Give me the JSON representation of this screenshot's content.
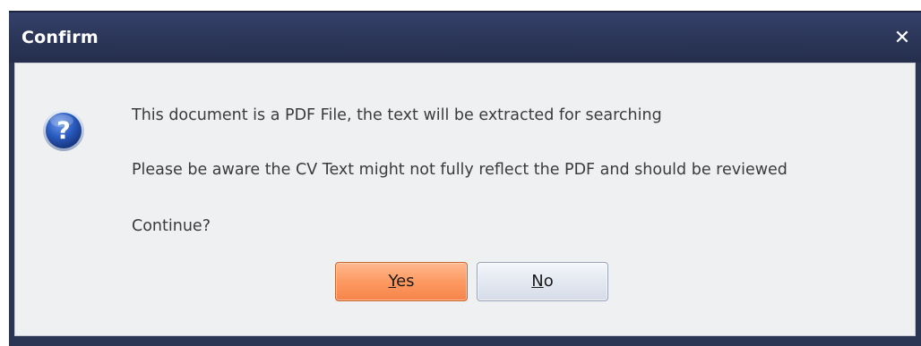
{
  "dialog": {
    "title": "Confirm",
    "close_glyph": "✕",
    "icon": "question-icon",
    "messages": [
      "This document is a PDF File, the text will be extracted for searching",
      "Please be aware the CV Text might not fully reflect the PDF and should be reviewed",
      "Continue?"
    ],
    "buttons": {
      "yes": {
        "mnemonic": "Y",
        "rest": "es"
      },
      "no": {
        "mnemonic": "N",
        "rest": "o"
      }
    }
  },
  "colors": {
    "titlebar": "#2b3554",
    "body": "#eff0f2",
    "yes_button": "#fc9a62",
    "no_button": "#e3e8f1",
    "icon_blue": "#1f4fa8"
  }
}
